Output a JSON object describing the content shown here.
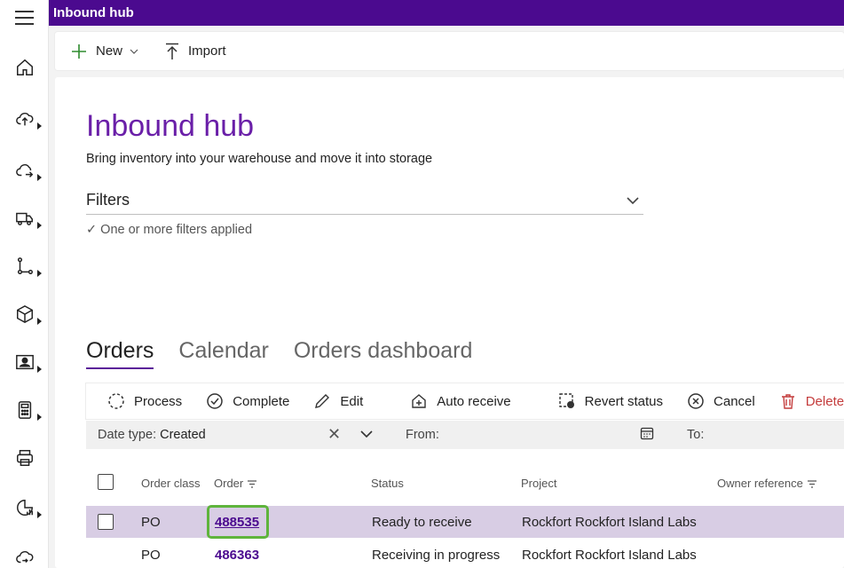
{
  "header": {
    "title": "Inbound hub"
  },
  "toolbar": {
    "new_label": "New",
    "import_label": "Import"
  },
  "page": {
    "title": "Inbound hub",
    "subtitle": "Bring inventory into your warehouse and move it into storage",
    "filters_label": "Filters",
    "filters_note": "✓ One or more filters applied"
  },
  "tabs": [
    {
      "label": "Orders"
    },
    {
      "label": "Calendar"
    },
    {
      "label": "Orders dashboard"
    }
  ],
  "grid_toolbar": {
    "process": "Process",
    "complete": "Complete",
    "edit": "Edit",
    "auto_receive": "Auto receive",
    "revert_status": "Revert status",
    "cancel": "Cancel",
    "delete": "Delete"
  },
  "date_filter": {
    "date_type_label": "Date type:",
    "date_type_value": "Created",
    "from_label": "From:",
    "to_label": "To:"
  },
  "columns": {
    "order_class": "Order class",
    "order": "Order",
    "status": "Status",
    "project": "Project",
    "owner_reference": "Owner reference"
  },
  "rows": [
    {
      "order_class": "PO",
      "order": "488535",
      "status": "Ready to receive",
      "project": "Rockfort Rockfort Island Labs"
    },
    {
      "order_class": "PO",
      "order": "486363",
      "status": "Receiving in progress",
      "project": "Rockfort Rockfort Island Labs"
    }
  ],
  "colors": {
    "brand": "#4b0a8f",
    "title": "#6a1fa8",
    "selected_row": "#d8cde4",
    "focus": "#5fb43c",
    "danger": "#c43c3c"
  }
}
